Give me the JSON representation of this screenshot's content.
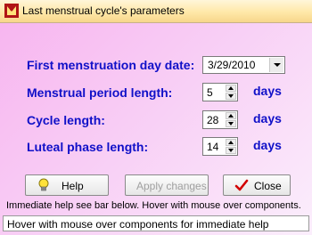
{
  "window": {
    "title": "Last menstrual cycle's parameters"
  },
  "form": {
    "first_day": {
      "label": "First menstruation day date:",
      "value": "3/29/2010"
    },
    "period_length": {
      "label": "Menstrual period length:",
      "value": "5",
      "unit": "days"
    },
    "cycle_length": {
      "label": "Cycle length:",
      "value": "28",
      "unit": "days"
    },
    "luteal_length": {
      "label": "Luteal phase length:",
      "value": "14",
      "unit": "days"
    }
  },
  "buttons": {
    "help": {
      "label": "Help",
      "icon": "light-bulb-icon"
    },
    "apply": {
      "label": "Apply changes",
      "enabled": false
    },
    "close": {
      "label": "Close",
      "icon": "checkmark-icon"
    }
  },
  "hint_text": "Immediate help see bar below. Hover with mouse over components.",
  "status_bar": "Hover with mouse over components for immediate help",
  "colors": {
    "label_blue": "#1010c8",
    "background": "#f8cdf5",
    "title_bar": "#ffe8a8"
  }
}
